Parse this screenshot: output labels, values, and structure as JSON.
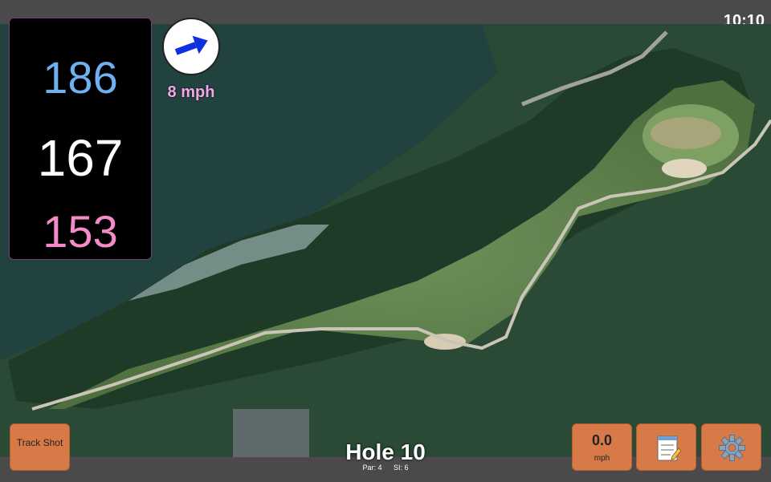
{
  "status": {
    "time": "10:10"
  },
  "distances": {
    "back": "186",
    "middle": "167",
    "front": "153"
  },
  "wind": {
    "speed": "8 mph",
    "icon": "wind-direction-arrow-icon"
  },
  "hole": {
    "title": "Hole 10",
    "par": "Par: 4",
    "si": "SI: 6"
  },
  "buttons": {
    "track_shot": "Track Shot",
    "speed_value": "0.0",
    "speed_unit": "mph",
    "notes_icon": "notepad-icon",
    "settings_icon": "gear-icon"
  },
  "colors": {
    "back_distance": "#6fb0f0",
    "middle_distance": "#ffffff",
    "front_distance": "#f58ac8",
    "button": "#d87a48",
    "wind_text": "#f0a8e8"
  }
}
